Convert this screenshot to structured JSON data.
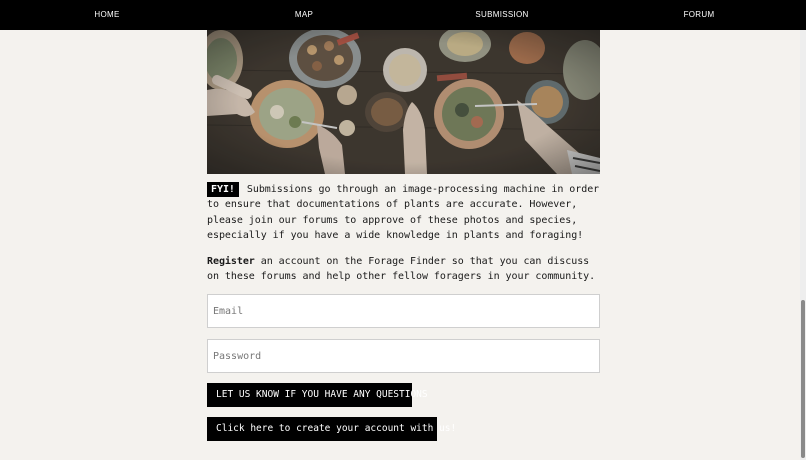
{
  "nav": {
    "items": [
      {
        "label": "HOME"
      },
      {
        "label": "MAP"
      },
      {
        "label": "SUBMISSION"
      },
      {
        "label": "FORUM"
      }
    ]
  },
  "hero": {
    "icon": "food-table-photo"
  },
  "fyi": {
    "tag": "FYI!",
    "text": "Submissions go through an image-processing machine in order to ensure that documentations of plants are accurate. However, please join our forums to approve of these photos and species, especially if you have a wide knowledge in plants and foraging!"
  },
  "register": {
    "bold": "Register",
    "text": "an account on the Forage Finder so that you can discuss on these forums and help other fellow foragers in your community."
  },
  "form": {
    "email_placeholder": "Email",
    "password_placeholder": "Password",
    "questions_button": "LET US KNOW IF YOU HAVE ANY QUESTIONS",
    "create_button": "Click here to create your account with us!"
  },
  "colors": {
    "background": "#f4f2ee",
    "nav": "#000000",
    "button": "#000000",
    "button_text": "#ffffff"
  }
}
